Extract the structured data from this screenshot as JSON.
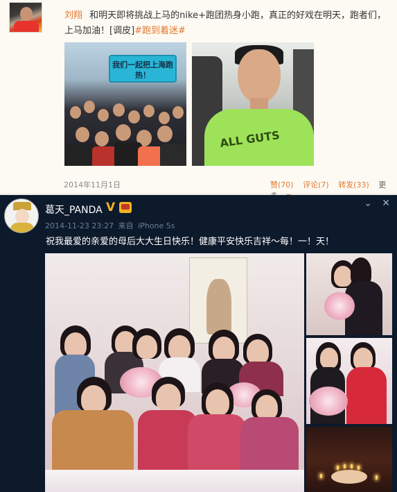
{
  "post1": {
    "author": "刘翔",
    "text": "和明天即将挑战上马的nike+跑团热身小跑，真正的好戏在明天，跑者们，上马加油！[调皮]",
    "hashtag": "#跑到着迷#",
    "image1_banner": "我们一起把上海跑热！",
    "image2_shirt_text": "ALL GUTS",
    "date": "2014年11月1日",
    "actions": {
      "like": "赞(70)",
      "comment": "评论(7)",
      "repost": "转发(33)",
      "more": "更多"
    },
    "icons": {
      "more": "chevron-down-icon"
    }
  },
  "post2": {
    "author": "葛天_PANDA",
    "verified_badge": "V",
    "timestamp": "2014-11-23 23:27",
    "source_prefix": "来自",
    "source": "iPhone 5s",
    "text": "祝我最爱的亲爱的母后大大生日快乐！健康平安快乐吉祥～每！一！天！",
    "controls": {
      "collapse": "⌄",
      "close": "✕"
    },
    "icons": {
      "verified": "verified-v-icon",
      "member": "crown-badge-icon",
      "collapse": "chevron-down-icon",
      "close": "close-icon"
    }
  },
  "colors": {
    "post1_bg": "#fdfaf3",
    "post2_bg": "#0d1a2c",
    "accent_orange": "#e1792f",
    "verified_gold": "#f3b320"
  }
}
